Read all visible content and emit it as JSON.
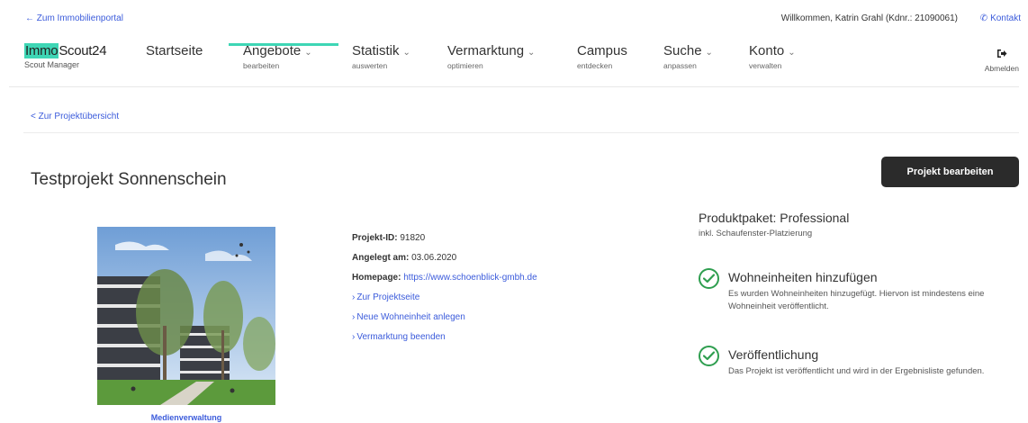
{
  "topbar": {
    "back_portal": "← Zum Immobilienportal",
    "welcome": "Willkommen, Katrin Grahl (Kdnr.: 21090061)",
    "contact": "Kontakt"
  },
  "logo": {
    "immo": "Immo",
    "scout": "Scout24",
    "sub": "Scout Manager"
  },
  "nav": {
    "items": [
      {
        "label": "Startseite",
        "sub": ""
      },
      {
        "label": "Angebote",
        "sub": "bearbeiten"
      },
      {
        "label": "Statistik",
        "sub": "auswerten"
      },
      {
        "label": "Vermarktung",
        "sub": "optimieren"
      },
      {
        "label": "Campus",
        "sub": "entdecken"
      },
      {
        "label": "Suche",
        "sub": "anpassen"
      },
      {
        "label": "Konto",
        "sub": "verwalten"
      }
    ],
    "logout": "Abmelden",
    "active_color": "#3ed6b5"
  },
  "breadcrumb": "< Zur Projektübersicht",
  "project": {
    "title": "Testprojekt Sonnenschein",
    "edit_button": "Projekt bearbeiten",
    "media_link": "Medienverwaltung",
    "id_label": "Projekt-ID:",
    "id_value": "91820",
    "created_label": "Angelegt am:",
    "created_value": "03.06.2020",
    "homepage_label": "Homepage:",
    "homepage_value": "https://www.schoenblick-gmbh.de",
    "links": [
      "Zur Projektseite",
      "Neue Wohneinheit anlegen",
      "Vermarktung beenden"
    ]
  },
  "package": {
    "title": "Produktpaket: Professional",
    "sub": "inkl. Schaufenster-Platzierung"
  },
  "statuses": [
    {
      "title": "Wohneinheiten hinzufügen",
      "text": "Es wurden Wohneinheiten hinzugefügt. Hiervon ist mindestens eine Wohneinheit veröffentlicht."
    },
    {
      "title": "Veröffentlichung",
      "text": "Das Projekt ist veröffentlicht und wird in der Ergebnisliste gefunden."
    }
  ],
  "colors": {
    "link": "#3b5bdb",
    "check": "#2e9e4f",
    "button": "#2b2b2b"
  }
}
